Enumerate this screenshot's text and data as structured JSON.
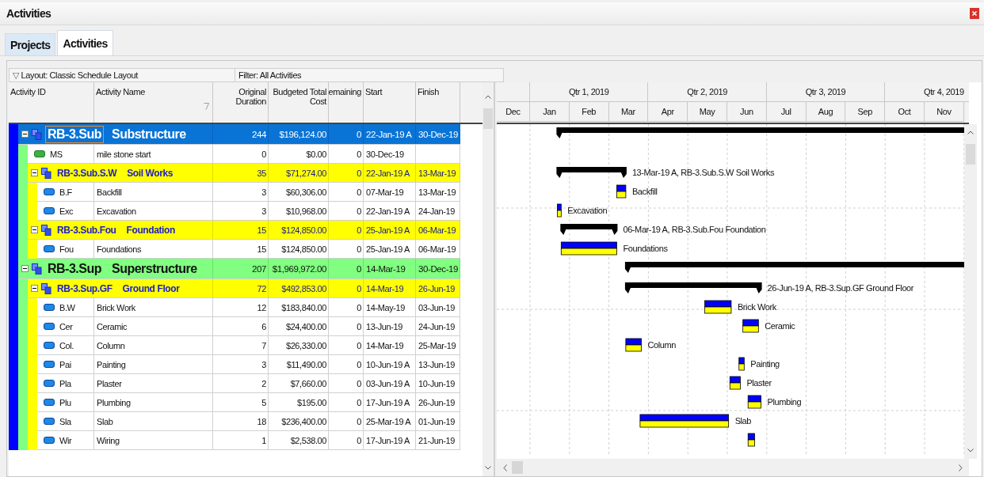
{
  "window": {
    "title": "Activities"
  },
  "tabs": [
    {
      "label": "Projects",
      "selected": false
    },
    {
      "label": "Activities",
      "selected": true
    }
  ],
  "toolbar": {
    "layout_toggle": "▽",
    "layout": "Layout: Classic Schedule Layout",
    "filter": "Filter: All Activities"
  },
  "table": {
    "columns": [
      "Activity ID",
      "Activity Name",
      "Original Duration",
      "Budgeted Total Cost",
      "emaining",
      "Start",
      "Finish"
    ],
    "project": {
      "color": "#0000ff",
      "children": [
        {
          "kind": "wbs",
          "id": "RB-3.Sub",
          "name": "Substructure",
          "color": "#80ff80",
          "expanded": true,
          "selected": true,
          "duration": "244",
          "cost": "$196,124.00",
          "remaining": "0",
          "start": "22-Jan-19 A",
          "finish": "30-Dec-19",
          "children": [
            {
              "kind": "milestone",
              "id": "MS",
              "name": "mile stone start",
              "selected": false,
              "duration": "0",
              "cost": "$0.00",
              "remaining": "0",
              "start": "30-Dec-19"
            },
            {
              "kind": "wbs",
              "id": "RB-3.Sub.S.W",
              "name": "Soil Works",
              "color": "#ffff00",
              "expanded": true,
              "selected": false,
              "duration": "35",
              "cost": "$71,274.00",
              "remaining": "0",
              "start": "22-Jan-19 A",
              "finish": "13-Mar-19",
              "bar_label": "13-Mar-19 A, RB-3.Sub.S.W  Soil Works",
              "children": [
                {
                  "kind": "task",
                  "id": "B.F",
                  "name": "Backfill",
                  "selected": false,
                  "duration": "3",
                  "cost": "$60,306.00",
                  "remaining": "0",
                  "start": "07-Mar-19",
                  "finish": "13-Mar-19",
                  "bar_label": "Backfill"
                },
                {
                  "kind": "task",
                  "id": "Exc",
                  "name": "Excavation",
                  "selected": false,
                  "duration": "3",
                  "cost": "$10,968.00",
                  "remaining": "0",
                  "start": "22-Jan-19 A",
                  "finish": "24-Jan-19",
                  "bar_label": "Excavation"
                }
              ]
            },
            {
              "kind": "wbs",
              "id": "RB-3.Sub.Fou",
              "name": "Foundation",
              "color": "#ffff00",
              "expanded": true,
              "selected": false,
              "duration": "15",
              "cost": "$124,850.00",
              "remaining": "0",
              "start": "25-Jan-19 A",
              "finish": "06-Mar-19",
              "bar_label": "06-Mar-19 A, RB-3.Sub.Fou  Foundation",
              "children": [
                {
                  "kind": "task",
                  "id": "Fou",
                  "name": "Foundations",
                  "selected": false,
                  "duration": "15",
                  "cost": "$124,850.00",
                  "remaining": "0",
                  "start": "25-Jan-19 A",
                  "finish": "06-Mar-19",
                  "bar_label": "Foundations"
                }
              ]
            }
          ]
        },
        {
          "kind": "wbs",
          "id": "RB-3.Sup",
          "name": "Superstructure",
          "color": "#80ff80",
          "expanded": true,
          "selected": false,
          "duration": "207",
          "cost": "$1,969,972.00",
          "remaining": "0",
          "start": "14-Mar-19",
          "finish": "30-Dec-19",
          "children": [
            {
              "kind": "wbs",
              "id": "RB-3.Sup.GF",
              "name": "Ground Floor",
              "color": "#ffff00",
              "expanded": true,
              "selected": false,
              "duration": "72",
              "cost": "$492,853.00",
              "remaining": "0",
              "start": "14-Mar-19",
              "finish": "26-Jun-19",
              "bar_label": "26-Jun-19 A, RB-3.Sup.GF  Ground Floor",
              "children": [
                {
                  "kind": "task",
                  "id": "B.W",
                  "name": "Brick Work",
                  "selected": false,
                  "duration": "12",
                  "cost": "$183,840.00",
                  "remaining": "0",
                  "start": "14-May-19",
                  "finish": "03-Jun-19",
                  "bar_label": "Brick Work"
                },
                {
                  "kind": "task",
                  "id": "Cer",
                  "name": "Ceramic",
                  "selected": false,
                  "duration": "6",
                  "cost": "$24,400.00",
                  "remaining": "0",
                  "start": "13-Jun-19",
                  "finish": "24-Jun-19",
                  "bar_label": "Ceramic"
                },
                {
                  "kind": "task",
                  "id": "Col.",
                  "name": "Column",
                  "selected": false,
                  "duration": "7",
                  "cost": "$26,330.00",
                  "remaining": "0",
                  "start": "14-Mar-19",
                  "finish": "25-Mar-19",
                  "bar_label": "Column"
                },
                {
                  "kind": "task",
                  "id": "Pai",
                  "name": "Painting",
                  "selected": false,
                  "duration": "3",
                  "cost": "$11,490.00",
                  "remaining": "0",
                  "start": "10-Jun-19 A",
                  "finish": "13-Jun-19",
                  "bar_label": "Painting"
                },
                {
                  "kind": "task",
                  "id": "Pla",
                  "name": "Plaster",
                  "selected": false,
                  "duration": "2",
                  "cost": "$7,660.00",
                  "remaining": "0",
                  "start": "03-Jun-19 A",
                  "finish": "10-Jun-19",
                  "bar_label": "Plaster"
                },
                {
                  "kind": "task",
                  "id": "Plu",
                  "name": "Plumbing",
                  "selected": false,
                  "duration": "5",
                  "cost": "$195.00",
                  "remaining": "0",
                  "start": "17-Jun-19 A",
                  "finish": "26-Jun-19",
                  "bar_label": "Plumbing"
                },
                {
                  "kind": "task",
                  "id": "Sla",
                  "name": "Slab",
                  "selected": false,
                  "duration": "18",
                  "cost": "$236,400.00",
                  "remaining": "0",
                  "start": "25-Mar-19 A",
                  "finish": "01-Jun-19",
                  "bar_label": "Slab"
                },
                {
                  "kind": "task",
                  "id": "Wir",
                  "name": "Wiring",
                  "selected": false,
                  "duration": "1",
                  "cost": "$2,538.00",
                  "remaining": "0",
                  "start": "17-Jun-19 A",
                  "finish": "21-Jun-19"
                }
              ]
            }
          ]
        }
      ]
    }
  },
  "gantt": {
    "quarters": [
      "Qtr 1, 2019",
      "Qtr 2, 2019",
      "Qtr 3, 2019",
      "Qtr 4, 2019"
    ],
    "months": [
      "Dec",
      "Jan",
      "Feb",
      "Mar",
      "Apr",
      "May",
      "Jun",
      "Jul",
      "Aug",
      "Sep",
      "Oct",
      "Nov"
    ]
  }
}
